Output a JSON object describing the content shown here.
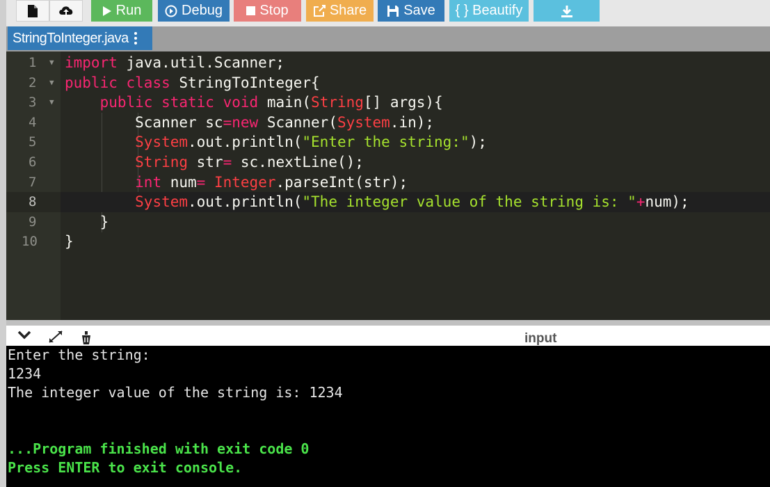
{
  "toolbar": {
    "run_label": "Run",
    "debug_label": "Debug",
    "stop_label": "Stop",
    "share_label": "Share",
    "save_label": "Save",
    "beautify_label": "{ } Beautify"
  },
  "file_tab": {
    "name": "StringToInteger.java"
  },
  "editor": {
    "line_numbers": [
      "1",
      "2",
      "3",
      "4",
      "5",
      "6",
      "7",
      "8",
      "9",
      "10"
    ],
    "active_line": 8
  },
  "console_bar": {
    "input_label": "input"
  },
  "console": {
    "lines": [
      "Enter the string:",
      "1234",
      "The integer value of the string is: 1234",
      "...Program finished with exit code 0",
      "Press ENTER to exit console."
    ]
  },
  "colors": {
    "run": "#5cb85c",
    "debug": "#337ab7",
    "stop": "#d9534f",
    "share": "#f0ad4e",
    "save": "#337ab7",
    "beautify": "#5bc0de",
    "download": "#5bc0de"
  }
}
